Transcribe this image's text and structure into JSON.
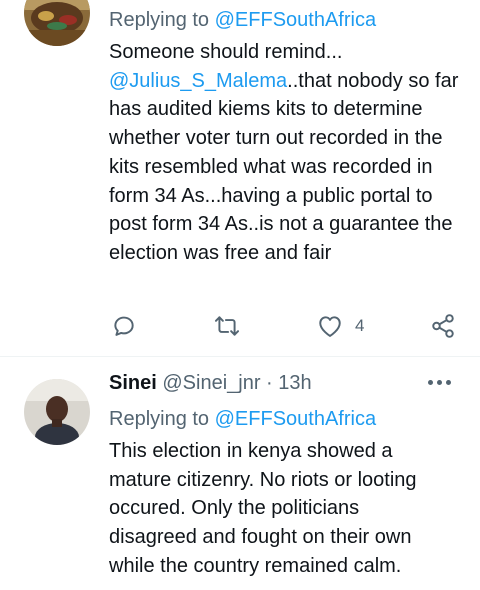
{
  "tweet1": {
    "replying_prefix": "Replying to ",
    "replying_handle": "@EFFSouthAfrica",
    "body_mention": "@Julius_S_Malema",
    "body_rest": "..that nobody so far has audited kiems kits to determine whether voter turn out recorded in the kits resembled what was recorded in form 34 As...having a public portal to post form 34 As..is not a guarantee the election was free and fair",
    "body_intro": "Someone should remind...",
    "like_count": "4"
  },
  "tweet2": {
    "display_name": "Sinei",
    "handle": "@Sinei_jnr",
    "separator": "·",
    "time": "13h",
    "replying_prefix": "Replying to ",
    "replying_handle": "@EFFSouthAfrica",
    "body": "This election in kenya showed a mature citizenry. No riots or looting occured. Only the politicians disagreed and fought on their own while the country remained calm."
  },
  "icons": {
    "reply": "reply-icon",
    "retweet": "retweet-icon",
    "like": "heart-icon",
    "share": "share-icon",
    "more": "more-icon"
  },
  "colors": {
    "accent": "#1d9bf0",
    "secondary_text": "#536471",
    "primary_text": "#0f1419",
    "divider": "#eff3f4"
  }
}
